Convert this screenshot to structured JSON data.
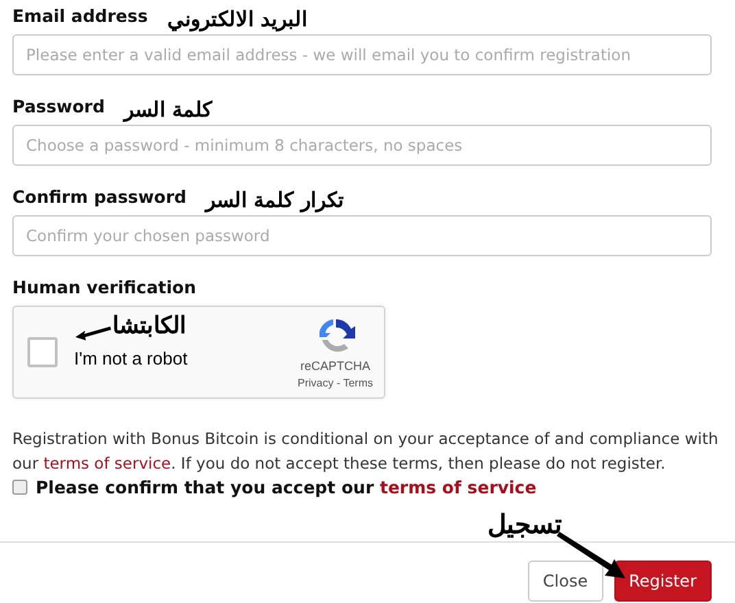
{
  "fields": [
    {
      "label": "Email address",
      "placeholder": "Please enter a valid email address - we will email you to confirm registration",
      "annotation": "البريد الالكتروني"
    },
    {
      "label": "Password",
      "placeholder": "Choose a password - minimum 8 characters, no spaces",
      "annotation": "كلمة السر"
    },
    {
      "label": "Confirm password",
      "placeholder": "Confirm your chosen password",
      "annotation": "تكرار كلمة السر"
    }
  ],
  "verification": {
    "label": "Human verification",
    "checkbox_label": "I'm not a robot",
    "checked": false,
    "brand": "reCAPTCHA",
    "links": "Privacy - Terms",
    "annotation": "الكابتشا"
  },
  "terms": {
    "before": "Registration with Bonus Bitcoin is conditional on your acceptance of and compliance with our",
    "link": "terms of service",
    "after": ". If you do not accept these terms, then please do not register."
  },
  "accept": {
    "text": "Please confirm that you accept our",
    "link": "terms of service",
    "checked": false
  },
  "buttons": [
    {
      "label": "Close",
      "kind": "secondary"
    },
    {
      "label": "Register",
      "kind": "primary",
      "annotation": "تسجيل"
    }
  ]
}
